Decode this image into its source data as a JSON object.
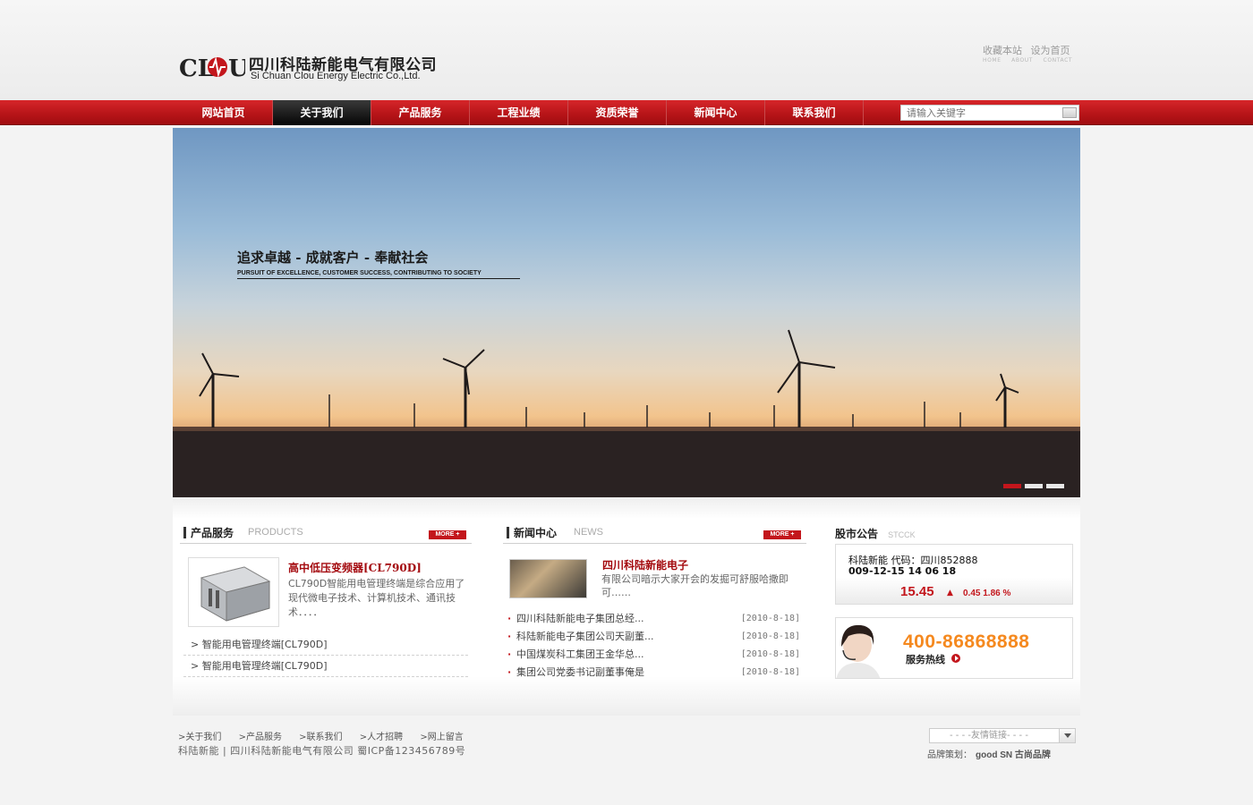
{
  "header": {
    "company_cn": "四川科陆新能电气有限公司",
    "company_en": "Si Chuan Clou Energy Electric Co.,Ltd.",
    "top_links": [
      "收藏本站",
      "设为首页"
    ],
    "top_links_en": [
      "HOME",
      "ABOUT",
      "CONTACT"
    ]
  },
  "nav": {
    "items": [
      "网站首页",
      "关于我们",
      "产品服务",
      "工程业绩",
      "资质荣誉",
      "新闻中心",
      "联系我们"
    ],
    "active_index": 1,
    "search_placeholder": "请输入关键字"
  },
  "banner": {
    "slogan_cn": "追求卓越  -  成就客户  -  奉献社会",
    "slogan_en": "PURSUIT OF EXCELLENCE, CUSTOMER SUCCESS, CONTRIBUTING TO SOCIETY",
    "slide_count": 3,
    "active_slide": 0
  },
  "products": {
    "title": "产品服务",
    "subtitle": "PRODUCTS",
    "more_label": "MORE +",
    "featured_title": "高中低压变频器[CL790D]",
    "featured_desc": "CL790D智能用电管理终端是综合应用了现代微电子技术、计算机技术、通讯技术．．．．",
    "list": [
      "> 智能用电管理终端[CL790D]",
      "> 智能用电管理终端[CL790D]"
    ]
  },
  "news": {
    "title": "新闻中心",
    "subtitle": "NEWS",
    "more_label": "MORE +",
    "featured_title": "四川科陆新能电子",
    "featured_desc": "有限公司暗示大家开会的发掘可舒服哈撒即可……",
    "items": [
      {
        "title": "四川科陆新能电子集团总经...",
        "date": "[2010-8-18]"
      },
      {
        "title": "科陆新能电子集团公司天副董...",
        "date": "[2010-8-18]"
      },
      {
        "title": "中国煤炭科工集团王金华总...",
        "date": "[2010-8-18]"
      },
      {
        "title": "集团公司党委书记副董事俺是",
        "date": "[2010-8-18]"
      }
    ]
  },
  "stock": {
    "title": "股市公告",
    "subtitle": "STCCK",
    "line1": "科陆新能  代码：四川852888",
    "line2": "009-12-15 14 06 18",
    "price": "15.45",
    "arrow": "▲",
    "change": "0.45 1.86 %"
  },
  "hotline": {
    "number": "400-86868888",
    "label": "服务热线"
  },
  "footer": {
    "links": [
      ">关于我们",
      ">产品服务",
      ">联系我们",
      ">人才招聘",
      ">网上留言"
    ],
    "copyright": "科陆新能 | 四川科陆新能电气有限公司   蜀ICP备123456789号",
    "friend_links": "- - - -友情链接- - - -",
    "brand_label": "品牌策划：",
    "brand_name": "good SN 古尚品牌"
  },
  "colors": {
    "brand_red": "#c3161c",
    "hotline_orange": "#f5891f",
    "nav_active": "#050505"
  }
}
